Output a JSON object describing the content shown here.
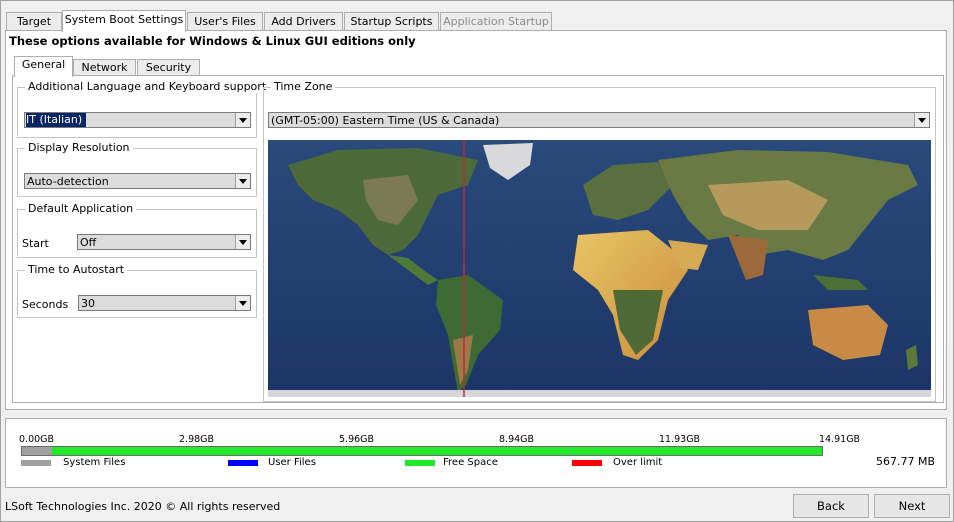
{
  "tabs": [
    {
      "label": "Target",
      "active": false,
      "disabled": false
    },
    {
      "label": "System Boot Settings",
      "active": true,
      "disabled": false
    },
    {
      "label": "User's Files",
      "active": false,
      "disabled": false
    },
    {
      "label": "Add Drivers",
      "active": false,
      "disabled": false
    },
    {
      "label": "Startup Scripts",
      "active": false,
      "disabled": false
    },
    {
      "label": "Application Startup",
      "active": false,
      "disabled": true
    }
  ],
  "banner": "These options available for Windows & Linux GUI editions only",
  "inner_tabs": [
    {
      "label": "General",
      "active": true
    },
    {
      "label": "Network",
      "active": false
    },
    {
      "label": "Security",
      "active": false
    }
  ],
  "language": {
    "legend": "Additional Language and Keyboard support",
    "value": "IT (Italian)"
  },
  "resolution": {
    "legend": "Display Resolution",
    "value": "Auto-detection"
  },
  "default_app": {
    "legend": "Default Application",
    "label": "Start",
    "value": "Off"
  },
  "autostart": {
    "legend": "Time to Autostart",
    "label": "Seconds",
    "value": "30"
  },
  "timezone": {
    "legend": "Time Zone",
    "value": "(GMT-05:00) Eastern Time (US & Canada)"
  },
  "storage": {
    "ticks": [
      "0.00GB",
      "2.98GB",
      "5.96GB",
      "8.94GB",
      "11.93GB",
      "14.91GB"
    ],
    "used_fraction": 0.038,
    "legend": [
      {
        "label": "System Files",
        "color": "#a0a0a0"
      },
      {
        "label": "User Files",
        "color": "#0000ff"
      },
      {
        "label": "Free Space",
        "color": "#22e82a"
      },
      {
        "label": "Over limit",
        "color": "#ff0000"
      }
    ],
    "total": "567.77 MB"
  },
  "footer": "LSoft Technologies Inc. 2020 © All rights reserved",
  "buttons": {
    "back": "Back",
    "next": "Next"
  },
  "colors": {
    "selection": "#0a246a",
    "meridian": "#c0283a"
  }
}
